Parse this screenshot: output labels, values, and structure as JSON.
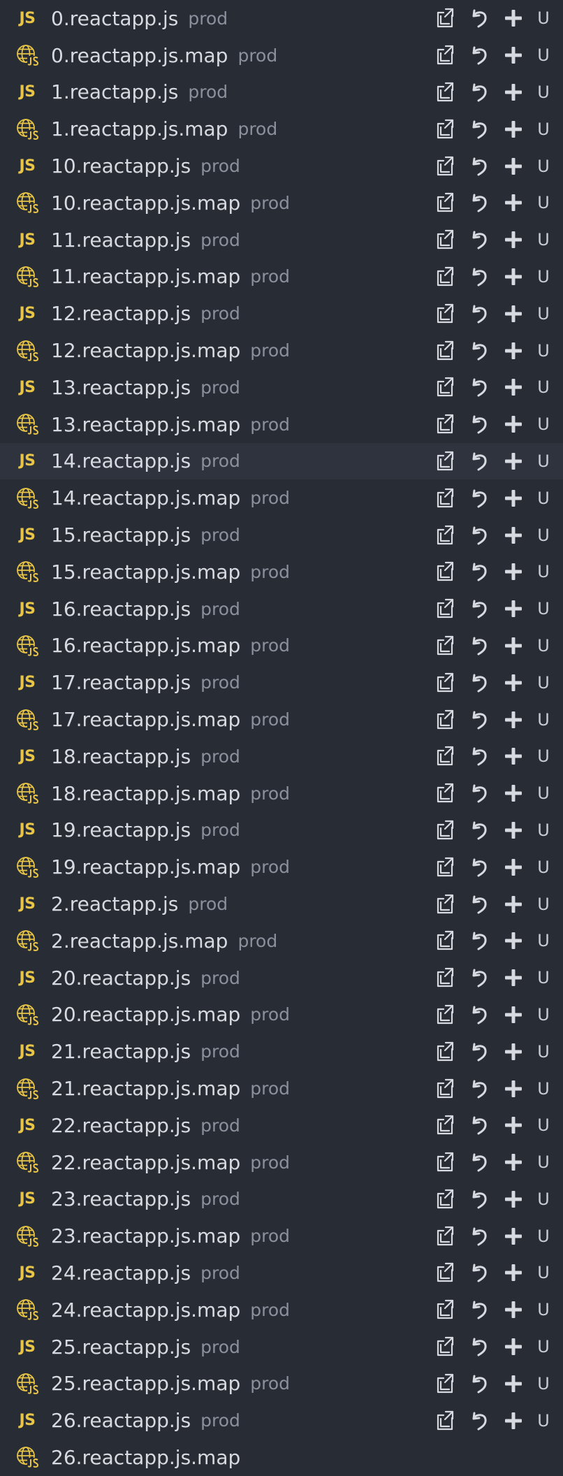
{
  "colors": {
    "background": "#282c34",
    "highlight": "#2f333d",
    "js_badge": "#e8c547",
    "icon": "#d7dae0"
  },
  "icons": {
    "js_file": "js-badge",
    "map_file": "globe-js-icon",
    "open_file": "open-file-icon",
    "discard": "discard-changes-icon",
    "stage": "stage-changes-icon"
  },
  "js_badge_text": "JS",
  "highlighted_index": 12,
  "files": [
    {
      "name": "0.reactapp.js",
      "desc": "prod",
      "type": "js",
      "status": "U"
    },
    {
      "name": "0.reactapp.js.map",
      "desc": "prod",
      "type": "map",
      "status": "U"
    },
    {
      "name": "1.reactapp.js",
      "desc": "prod",
      "type": "js",
      "status": "U"
    },
    {
      "name": "1.reactapp.js.map",
      "desc": "prod",
      "type": "map",
      "status": "U"
    },
    {
      "name": "10.reactapp.js",
      "desc": "prod",
      "type": "js",
      "status": "U"
    },
    {
      "name": "10.reactapp.js.map",
      "desc": "prod",
      "type": "map",
      "status": "U"
    },
    {
      "name": "11.reactapp.js",
      "desc": "prod",
      "type": "js",
      "status": "U"
    },
    {
      "name": "11.reactapp.js.map",
      "desc": "prod",
      "type": "map",
      "status": "U"
    },
    {
      "name": "12.reactapp.js",
      "desc": "prod",
      "type": "js",
      "status": "U"
    },
    {
      "name": "12.reactapp.js.map",
      "desc": "prod",
      "type": "map",
      "status": "U"
    },
    {
      "name": "13.reactapp.js",
      "desc": "prod",
      "type": "js",
      "status": "U"
    },
    {
      "name": "13.reactapp.js.map",
      "desc": "prod",
      "type": "map",
      "status": "U"
    },
    {
      "name": "14.reactapp.js",
      "desc": "prod",
      "type": "js",
      "status": "U"
    },
    {
      "name": "14.reactapp.js.map",
      "desc": "prod",
      "type": "map",
      "status": "U"
    },
    {
      "name": "15.reactapp.js",
      "desc": "prod",
      "type": "js",
      "status": "U"
    },
    {
      "name": "15.reactapp.js.map",
      "desc": "prod",
      "type": "map",
      "status": "U"
    },
    {
      "name": "16.reactapp.js",
      "desc": "prod",
      "type": "js",
      "status": "U"
    },
    {
      "name": "16.reactapp.js.map",
      "desc": "prod",
      "type": "map",
      "status": "U"
    },
    {
      "name": "17.reactapp.js",
      "desc": "prod",
      "type": "js",
      "status": "U"
    },
    {
      "name": "17.reactapp.js.map",
      "desc": "prod",
      "type": "map",
      "status": "U"
    },
    {
      "name": "18.reactapp.js",
      "desc": "prod",
      "type": "js",
      "status": "U"
    },
    {
      "name": "18.reactapp.js.map",
      "desc": "prod",
      "type": "map",
      "status": "U"
    },
    {
      "name": "19.reactapp.js",
      "desc": "prod",
      "type": "js",
      "status": "U"
    },
    {
      "name": "19.reactapp.js.map",
      "desc": "prod",
      "type": "map",
      "status": "U"
    },
    {
      "name": "2.reactapp.js",
      "desc": "prod",
      "type": "js",
      "status": "U"
    },
    {
      "name": "2.reactapp.js.map",
      "desc": "prod",
      "type": "map",
      "status": "U"
    },
    {
      "name": "20.reactapp.js",
      "desc": "prod",
      "type": "js",
      "status": "U"
    },
    {
      "name": "20.reactapp.js.map",
      "desc": "prod",
      "type": "map",
      "status": "U"
    },
    {
      "name": "21.reactapp.js",
      "desc": "prod",
      "type": "js",
      "status": "U"
    },
    {
      "name": "21.reactapp.js.map",
      "desc": "prod",
      "type": "map",
      "status": "U"
    },
    {
      "name": "22.reactapp.js",
      "desc": "prod",
      "type": "js",
      "status": "U"
    },
    {
      "name": "22.reactapp.js.map",
      "desc": "prod",
      "type": "map",
      "status": "U"
    },
    {
      "name": "23.reactapp.js",
      "desc": "prod",
      "type": "js",
      "status": "U"
    },
    {
      "name": "23.reactapp.js.map",
      "desc": "prod",
      "type": "map",
      "status": "U"
    },
    {
      "name": "24.reactapp.js",
      "desc": "prod",
      "type": "js",
      "status": "U"
    },
    {
      "name": "24.reactapp.js.map",
      "desc": "prod",
      "type": "map",
      "status": "U"
    },
    {
      "name": "25.reactapp.js",
      "desc": "prod",
      "type": "js",
      "status": "U"
    },
    {
      "name": "25.reactapp.js.map",
      "desc": "prod",
      "type": "map",
      "status": "U"
    },
    {
      "name": "26.reactapp.js",
      "desc": "prod",
      "type": "js",
      "status": "U"
    },
    {
      "name": "26.reactapp.js.map",
      "desc": "",
      "type": "map",
      "status": ""
    }
  ]
}
